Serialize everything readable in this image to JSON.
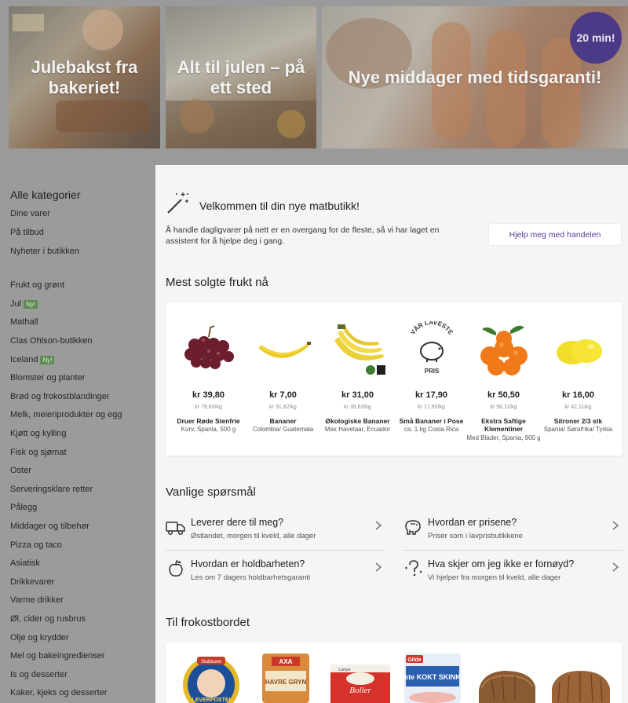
{
  "banners": [
    {
      "title": "Julebakst fra bakeriet!"
    },
    {
      "title": "Alt til julen – på ett sted"
    },
    {
      "title": "Nye middager med tidsgaranti!",
      "badge": "20 min!"
    }
  ],
  "sidebar": {
    "heading": "Alle kategorier",
    "top_items": [
      "Dine varer",
      "På tilbud",
      "Nyheter i butikken"
    ],
    "categories": [
      {
        "label": "Frukt og grønt"
      },
      {
        "label": "Jul",
        "tag": "Ny!"
      },
      {
        "label": "Mathall"
      },
      {
        "label": "Clas Ohlson-butikken"
      },
      {
        "label": "Iceland",
        "tag": "Ny!"
      },
      {
        "label": "Blomster og planter"
      },
      {
        "label": "Brød og frokostblandinger"
      },
      {
        "label": "Melk, meieriprodukter og egg"
      },
      {
        "label": "Kjøtt og kylling"
      },
      {
        "label": "Fisk og sjømat"
      },
      {
        "label": "Oster"
      },
      {
        "label": "Serveringsklare retter"
      },
      {
        "label": "Pålegg"
      },
      {
        "label": "Middager og tilbehør"
      },
      {
        "label": "Pizza og taco"
      },
      {
        "label": "Asiatisk"
      },
      {
        "label": "Drikkevarer"
      },
      {
        "label": "Varme drikker"
      },
      {
        "label": "Øl, cider og rusbrus"
      },
      {
        "label": "Olje og krydder"
      },
      {
        "label": "Mel og bakeingredienser"
      },
      {
        "label": "Is og desserter"
      },
      {
        "label": "Kaker, kjeks og desserter"
      }
    ]
  },
  "welcome": {
    "title": "Velkommen til din nye matbutikk!",
    "text": "Å handle dagligvarer på nett er en overgang for de fleste, så vi har laget en assistent for å hjelpe deg i gang.",
    "button": "Hjelp meg med handelen"
  },
  "bestsellers": {
    "title": "Mest solgte frukt nå",
    "products": [
      {
        "price": "kr 39,80",
        "unit": "kr 79,60/kg",
        "name": "Druer Røde Stenfrie",
        "desc": "Kurv, Spania, 500 g",
        "icon": "grapes"
      },
      {
        "price": "kr 7,00",
        "unit": "kr 31,82/kg",
        "name": "Bananer",
        "desc": "Colombia/ Guatemala",
        "icon": "banana"
      },
      {
        "price": "kr 31,00",
        "unit": "kr 35,63/kg",
        "name": "Økologiske Bananer",
        "desc": "Max Havelaar, Ecuador",
        "icon": "bananas-bunch",
        "badges": "Øko"
      },
      {
        "price": "kr 17,90",
        "unit": "kr 17,90/kg",
        "name": "Små Bananer i Pose",
        "desc": "ca. 1 kg Costa Rica",
        "icon": "var-laveste-pris",
        "logo_text_top": "VÅR LAVESTE",
        "logo_text_bottom": "PRIS"
      },
      {
        "price": "kr 50,50",
        "unit": "kr 56,11/kg",
        "name": "Ekstra Saftige Klementiner",
        "desc": "Med Blader, Spania, 900 g",
        "icon": "clementines"
      },
      {
        "price": "kr 16,00",
        "unit": "kr 42,11/kg",
        "name": "Sitroner 2/3 stk",
        "desc": "Spania/ Sørafrika/ Tyrkia",
        "icon": "lemons"
      }
    ]
  },
  "faq": {
    "title": "Vanlige spørsmål",
    "items": [
      {
        "q": "Leverer dere til meg?",
        "a": "Østlandet, morgen til kveld, alle dager",
        "icon": "truck-icon"
      },
      {
        "q": "Hvordan er prisene?",
        "a": "Priser som i lavprisbutikkene",
        "icon": "piggy-bank-icon"
      },
      {
        "q": "Hvordan er holdbarheten?",
        "a": "Les om 7 dagers holdbarhetsgaranti",
        "icon": "apple-icon"
      },
      {
        "q": "Hva skjer om jeg ikke er fornøyd?",
        "a": "Vi hjelper fra morgen til kveld, alle dager",
        "icon": "question-icon"
      }
    ]
  },
  "breakfast": {
    "title": "Til frokostbordet",
    "products": [
      {
        "icon": "leverpostei",
        "brand": "Stabburet",
        "label": "LEVERPOSTEI"
      },
      {
        "icon": "havregryn",
        "brand": "AXA",
        "label": "HAVRE GRYN"
      },
      {
        "icon": "boller",
        "brand": "Lampe",
        "label": "Boller"
      },
      {
        "icon": "kokt-skinke",
        "brand": "Gilde",
        "label": "Ekte KOKT SKINKE"
      },
      {
        "icon": "bread",
        "label": ""
      },
      {
        "icon": "bread-2",
        "label": ""
      }
    ]
  }
}
